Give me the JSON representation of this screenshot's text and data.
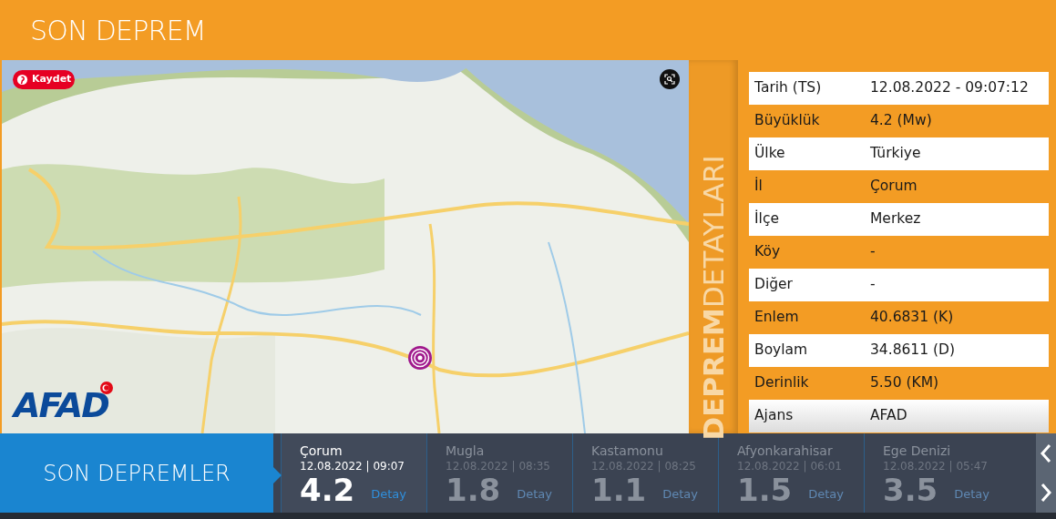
{
  "header": {
    "title": "SON DEPREM"
  },
  "map": {
    "kind": "picture",
    "save_button": "Kaydet",
    "logo": "AFAD"
  },
  "details": {
    "side_title_bold": "DEPREM",
    "side_title": "DETAYLARI",
    "rows": [
      {
        "label": "Tarih (TS)",
        "value": "12.08.2022 - 09:07:12"
      },
      {
        "label": "Büyüklük",
        "value": "4.2 (Mw)"
      },
      {
        "label": "Ülke",
        "value": "Türkiye"
      },
      {
        "label": "İl",
        "value": "Çorum"
      },
      {
        "label": "İlçe",
        "value": "Merkez"
      },
      {
        "label": "Köy",
        "value": "-"
      },
      {
        "label": "Diğer",
        "value": "-"
      },
      {
        "label": "Enlem",
        "value": "40.6831 (K)"
      },
      {
        "label": "Boylam",
        "value": "34.8611 (D)"
      },
      {
        "label": "Derinlik",
        "value": "5.50 (KM)"
      },
      {
        "label": "Ajans",
        "value": "AFAD"
      }
    ]
  },
  "recent": {
    "title": "SON DEPREMLER",
    "items": [
      {
        "place": "Çorum",
        "time": "12.08.2022 | 09:07",
        "magnitude": "4.2",
        "link": "Detay",
        "selected": true
      },
      {
        "place": "Mugla",
        "time": "12.08.2022 | 08:35",
        "magnitude": "1.8",
        "link": "Detay",
        "selected": false
      },
      {
        "place": "Kastamonu",
        "time": "12.08.2022 | 08:25",
        "magnitude": "1.1",
        "link": "Detay",
        "selected": false
      },
      {
        "place": "Afyonkarahisar",
        "time": "12.08.2022 | 06:01",
        "magnitude": "1.5",
        "link": "Detay",
        "selected": false
      },
      {
        "place": "Ege Denizi",
        "time": "12.08.2022 | 05:47",
        "magnitude": "3.5",
        "link": "Detay",
        "selected": false
      }
    ]
  }
}
